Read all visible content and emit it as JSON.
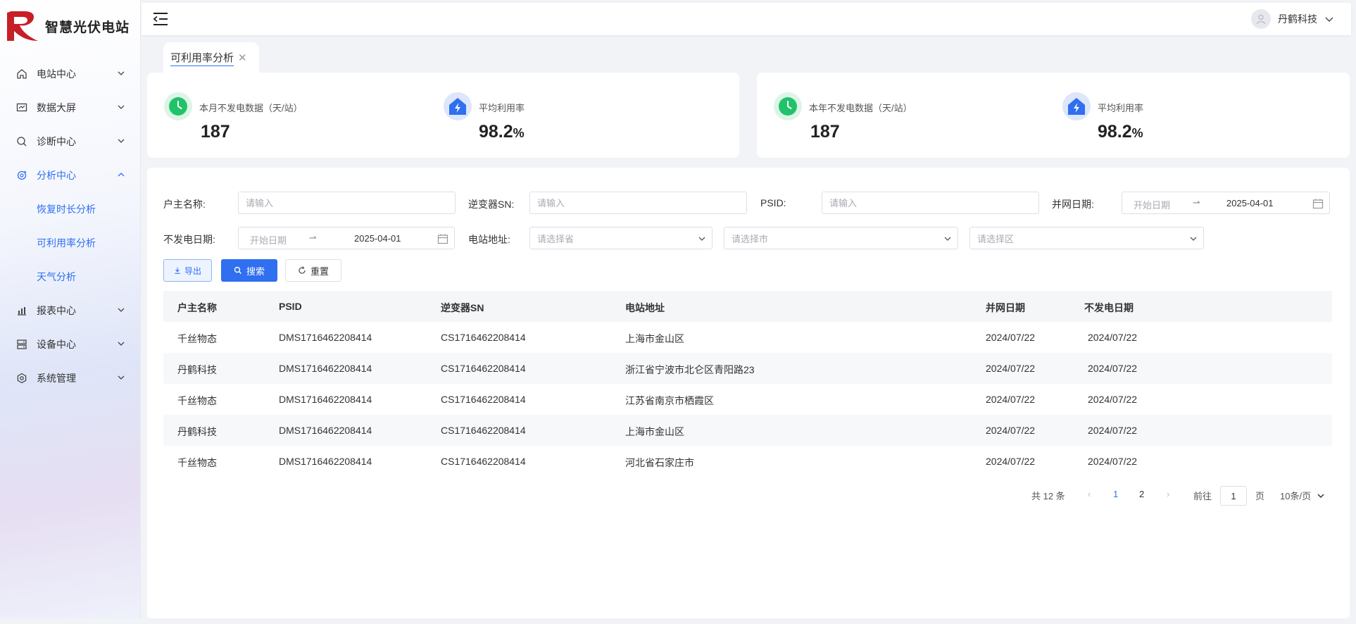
{
  "app": {
    "title": "智慧光伏电站",
    "brand_color": "#2f6ff0"
  },
  "sidebar": {
    "items": [
      {
        "label": "电站中心",
        "icon": "home-icon",
        "expanded": false
      },
      {
        "label": "数据大屏",
        "icon": "chart-monitor-icon",
        "expanded": false
      },
      {
        "label": "诊断中心",
        "icon": "magnifier-icon",
        "expanded": false
      },
      {
        "label": "分析中心",
        "icon": "analysis-icon",
        "expanded": true
      },
      {
        "label": "报表中心",
        "icon": "bar-chart-icon",
        "expanded": false
      },
      {
        "label": "设备中心",
        "icon": "device-icon",
        "expanded": false
      },
      {
        "label": "系统管理",
        "icon": "gear-icon",
        "expanded": false
      }
    ],
    "submenu": [
      {
        "label": "恢复时长分析"
      },
      {
        "label": "可利用率分析"
      },
      {
        "label": "天气分析"
      }
    ]
  },
  "header": {
    "user_name": "丹鹤科技"
  },
  "tabs": [
    {
      "label": "可利用率分析",
      "close": "✕"
    }
  ],
  "stats": {
    "month_no_power_label": "本月不发电数据（天/站）",
    "month_no_power_value": "187",
    "month_avg_rate_label": "平均利用率",
    "month_avg_rate_value": "98.2",
    "month_avg_rate_unit": "%",
    "year_no_power_label": "本年不发电数据（天/站）",
    "year_no_power_value": "187",
    "year_avg_rate_label": "平均利用率",
    "year_avg_rate_value": "98.2",
    "year_avg_rate_unit": "%"
  },
  "filters": {
    "owner_label": "户主名称:",
    "owner_placeholder": "请输入",
    "inverter_label": "逆变器SN:",
    "inverter_placeholder": "请输入",
    "psid_label": "PSID:",
    "psid_placeholder": "请输入",
    "grid_date_label": "并网日期:",
    "grid_date_start": "开始日期",
    "grid_date_sep": "⇀",
    "grid_date_end": "2025-04-01",
    "no_power_date_label": "不发电日期:",
    "no_power_date_start": "开始日期",
    "no_power_date_sep": "⇀",
    "no_power_date_end": "2025-04-01",
    "address_label": "电站地址:",
    "province_placeholder": "请选择省",
    "city_placeholder": "请选择市",
    "district_placeholder": "请选择区"
  },
  "buttons": {
    "export": "导出",
    "search": "搜索",
    "reset": "重置"
  },
  "table": {
    "columns": [
      "户主名称",
      "PSID",
      "逆变器SN",
      "电站地址",
      "并网日期",
      "不发电日期"
    ],
    "rows": [
      [
        "千丝物态",
        "DMS1716462208414",
        "CS1716462208414",
        "上海市金山区",
        "2024/07/22",
        "2024/07/22"
      ],
      [
        "丹鹤科技",
        "DMS1716462208414",
        "CS1716462208414",
        "浙江省宁波市北仑区青阳路23",
        "2024/07/22",
        "2024/07/22"
      ],
      [
        "千丝物态",
        "DMS1716462208414",
        "CS1716462208414",
        "江苏省南京市栖霞区",
        "2024/07/22",
        "2024/07/22"
      ],
      [
        "丹鹤科技",
        "DMS1716462208414",
        "CS1716462208414",
        "上海市金山区",
        "2024/07/22",
        "2024/07/22"
      ],
      [
        "千丝物态",
        "DMS1716462208414",
        "CS1716462208414",
        "河北省石家庄市",
        "2024/07/22",
        "2024/07/22"
      ]
    ]
  },
  "pagination": {
    "total_text": "共 12 条",
    "prev": "‹",
    "pages": [
      "1",
      "2"
    ],
    "current_page": "1",
    "next": "›",
    "goto_label": "前往",
    "goto_value": "1",
    "page_suffix": "页",
    "page_size": "10条/页"
  }
}
